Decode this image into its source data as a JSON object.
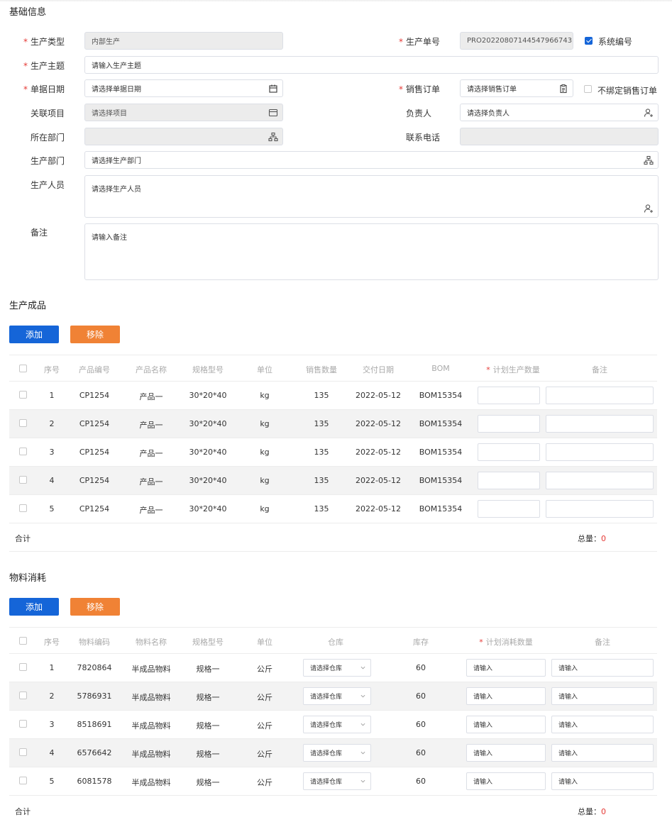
{
  "basic": {
    "title": "基础信息",
    "prod_type": {
      "label": "生产类型",
      "value": "内部生产"
    },
    "prod_no": {
      "label": "生产单号",
      "value": "PRO20220807144547966743",
      "auto_label": "系统编号"
    },
    "subject": {
      "label": "生产主题",
      "placeholder": "请输入生产主题"
    },
    "doc_date": {
      "label": "单据日期",
      "placeholder": "请选择单据日期"
    },
    "sales_order": {
      "label": "销售订单",
      "placeholder": "请选择销售订单",
      "unbind_label": "不绑定销售订单"
    },
    "project": {
      "label": "关联项目",
      "placeholder": "请选择项目"
    },
    "owner": {
      "label": "负责人",
      "placeholder": "请选择负责人"
    },
    "dept": {
      "label": "所在部门",
      "value": ""
    },
    "phone": {
      "label": "联系电话",
      "value": ""
    },
    "prod_dept": {
      "label": "生产部门",
      "placeholder": "请选择生产部门"
    },
    "staff": {
      "label": "生产人员",
      "placeholder": "请选择生产人员"
    },
    "note": {
      "label": "备注",
      "placeholder": "请输入备注"
    }
  },
  "products": {
    "title": "生产成品",
    "add_label": "添加",
    "remove_label": "移除",
    "headers": [
      "序号",
      "产品编号",
      "产品名称",
      "规格型号",
      "单位",
      "销售数量",
      "交付日期",
      "BOM",
      "计划生产数量",
      "备注"
    ],
    "rows": [
      {
        "no": "1",
        "code": "CP1254",
        "name": "产品一",
        "spec": "30*20*40",
        "unit": "kg",
        "qty": "135",
        "date": "2022-05-12",
        "bom": "BOM15354"
      },
      {
        "no": "2",
        "code": "CP1254",
        "name": "产品一",
        "spec": "30*20*40",
        "unit": "kg",
        "qty": "135",
        "date": "2022-05-12",
        "bom": "BOM15354"
      },
      {
        "no": "3",
        "code": "CP1254",
        "name": "产品一",
        "spec": "30*20*40",
        "unit": "kg",
        "qty": "135",
        "date": "2022-05-12",
        "bom": "BOM15354"
      },
      {
        "no": "4",
        "code": "CP1254",
        "name": "产品一",
        "spec": "30*20*40",
        "unit": "kg",
        "qty": "135",
        "date": "2022-05-12",
        "bom": "BOM15354"
      },
      {
        "no": "5",
        "code": "CP1254",
        "name": "产品一",
        "spec": "30*20*40",
        "unit": "kg",
        "qty": "135",
        "date": "2022-05-12",
        "bom": "BOM15354"
      }
    ],
    "sum_label": "合计",
    "total_label": "总量：",
    "total_value": "0"
  },
  "materials": {
    "title": "物料消耗",
    "add_label": "添加",
    "remove_label": "移除",
    "headers": [
      "序号",
      "物料编码",
      "物料名称",
      "规格型号",
      "单位",
      "仓库",
      "库存",
      "计划消耗数量",
      "备注"
    ],
    "rows": [
      {
        "no": "1",
        "code": "7820864",
        "name": "半成品物料",
        "spec": "规格一",
        "unit": "公斤",
        "stock": "60"
      },
      {
        "no": "2",
        "code": "5786931",
        "name": "半成品物料",
        "spec": "规格一",
        "unit": "公斤",
        "stock": "60"
      },
      {
        "no": "3",
        "code": "8518691",
        "name": "半成品物料",
        "spec": "规格一",
        "unit": "公斤",
        "stock": "60"
      },
      {
        "no": "4",
        "code": "6576642",
        "name": "半成品物料",
        "spec": "规格一",
        "unit": "公斤",
        "stock": "60"
      },
      {
        "no": "5",
        "code": "6081578",
        "name": "半成品物料",
        "spec": "规格一",
        "unit": "公斤",
        "stock": "60"
      }
    ],
    "warehouse_placeholder": "请选择仓库",
    "input_placeholder": "请输入",
    "sum_label": "合计",
    "total_label": "总量：",
    "total_value": "0"
  },
  "colors": {
    "primary": "#1565d8",
    "danger": "#f08235",
    "required": "#e53935"
  }
}
